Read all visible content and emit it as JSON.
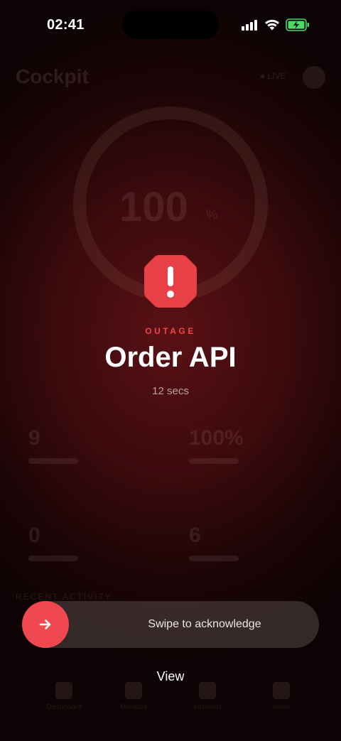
{
  "status_bar": {
    "time": "02:41"
  },
  "background_app": {
    "title": "Cockpit",
    "live_label": "● LIVE",
    "gauge_value": "100",
    "gauge_unit": "%",
    "stats": [
      "9",
      "100%",
      "0",
      "6"
    ],
    "section_label": "RECENT ACTIVITY",
    "tabs": [
      "Dashboard",
      "Monitors",
      "Incidents",
      "Inbox"
    ]
  },
  "alert": {
    "icon": "octagon-exclamation-icon",
    "eyebrow": "OUTAGE",
    "title": "Order API",
    "duration": "12 secs",
    "accent_color": "#f04449"
  },
  "actions": {
    "swipe_label": "Swipe to acknowledge",
    "swipe_icon": "arrow-right-icon",
    "view_label": "View"
  }
}
